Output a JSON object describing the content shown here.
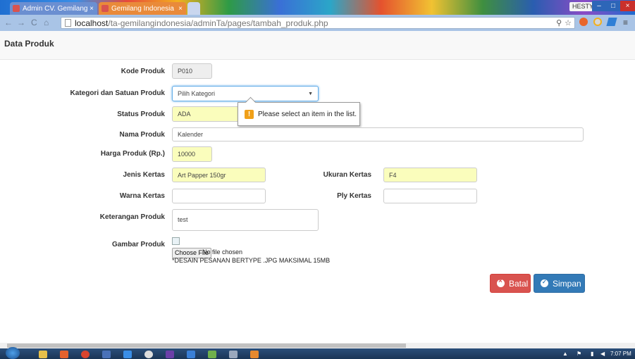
{
  "browser": {
    "tabs": [
      {
        "title": "Admin CV. Gemilang Indo",
        "close": "×"
      },
      {
        "title": "Gemilang Indonesia",
        "close": "×"
      }
    ],
    "user_badge": "HESTY",
    "win_min": "–",
    "win_max": "□",
    "win_close": "×",
    "url_host": "localhost",
    "url_path": "/ta-gemilangindonesia/adminTa/pages/tambah_produk.php",
    "back": "←",
    "forward": "→",
    "reload": "C",
    "home": "⌂",
    "zoom_icon": "⚲",
    "star_icon": "☆"
  },
  "page": {
    "title": "Data Produk"
  },
  "form": {
    "kode_label": "Kode Produk",
    "kode_value": "P010",
    "kategori_label": "Kategori dan Satuan Produk",
    "kategori_value": "Pilih Kategori",
    "status_label": "Status Produk",
    "status_value": "ADA",
    "nama_label": "Nama Produk",
    "nama_value": "Kalender",
    "harga_label": "Harga Produk (Rp.)",
    "harga_value": "10000",
    "jenis_label": "Jenis Kertas",
    "jenis_value": "Art Papper 150gr",
    "ukuran_label": "Ukuran Kertas",
    "ukuran_value": "F4",
    "warna_label": "Warna Kertas",
    "warna_value": "",
    "ply_label": "Ply Kertas",
    "ply_value": "",
    "keterangan_label": "Keterangan Produk",
    "keterangan_value": "test",
    "gambar_label": "Gambar Produk",
    "file_button": "Choose File",
    "file_status": "No file chosen",
    "file_note": "*DESAIN PESANAN BERTYPE .JPG MAKSIMAL 15MB"
  },
  "validation": {
    "message": "Please select an item in the list.",
    "icon": "!"
  },
  "actions": {
    "batal": "Batal",
    "simpan": "Simpan"
  },
  "taskbar": {
    "clock": "7:07 PM"
  },
  "colors": {
    "autofill": "#fafdbc",
    "danger": "#d9534f",
    "primary": "#337ab7"
  }
}
